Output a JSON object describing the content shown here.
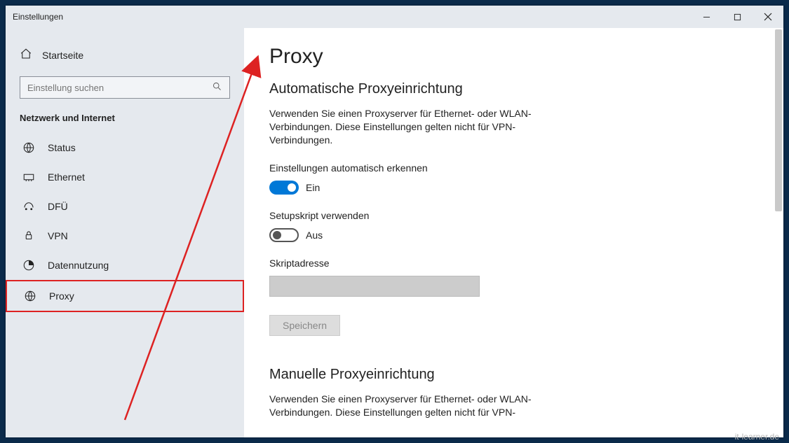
{
  "window": {
    "title": "Einstellungen"
  },
  "sidebar": {
    "home_label": "Startseite",
    "search_placeholder": "Einstellung suchen",
    "header": "Netzwerk und Internet",
    "items": [
      {
        "label": "Status"
      },
      {
        "label": "Ethernet"
      },
      {
        "label": "DFÜ"
      },
      {
        "label": "VPN"
      },
      {
        "label": "Datennutzung"
      },
      {
        "label": "Proxy"
      }
    ]
  },
  "main": {
    "page_title": "Proxy",
    "auto_section": {
      "title": "Automatische Proxyeinrichtung",
      "desc": "Verwenden Sie einen Proxyserver für Ethernet- oder WLAN-Verbindungen. Diese Einstellungen gelten nicht für VPN-Verbindungen.",
      "detect_label": "Einstellungen automatisch erkennen",
      "detect_state": "Ein",
      "script_label": "Setupskript verwenden",
      "script_state": "Aus",
      "addr_label": "Skriptadresse",
      "save_button": "Speichern"
    },
    "manual_section": {
      "title": "Manuelle Proxyeinrichtung",
      "desc": "Verwenden Sie einen Proxyserver für Ethernet- oder WLAN-Verbindungen. Diese Einstellungen gelten nicht für VPN-"
    }
  },
  "watermark": "it-learner.de"
}
